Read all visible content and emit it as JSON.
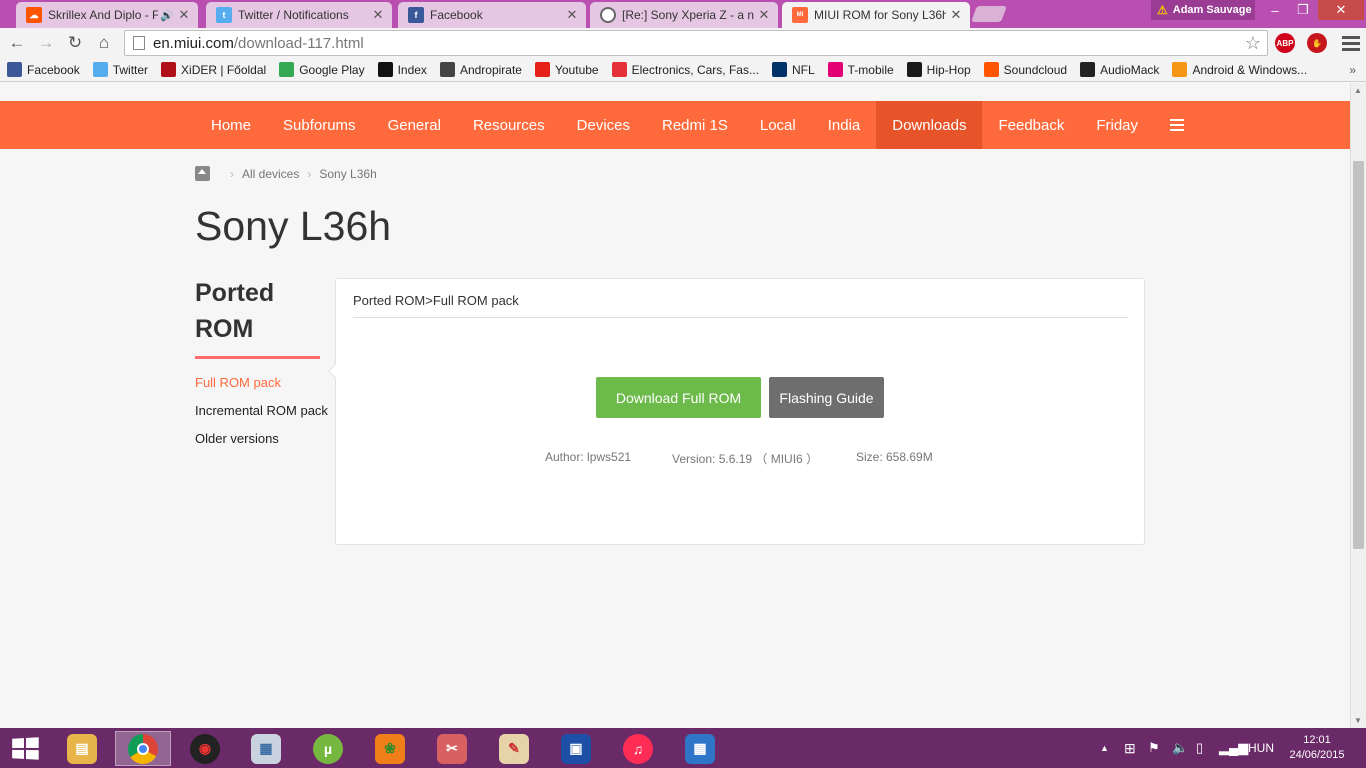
{
  "browser": {
    "tabs": [
      {
        "title": "Skrillex And Diplo - Fel",
        "icon": "soundcloud-icon",
        "color": "#ff5500",
        "audio": true,
        "active": false
      },
      {
        "title": "Twitter / Notifications",
        "icon": "twitter-icon",
        "color": "#55acee",
        "active": false
      },
      {
        "title": "Facebook",
        "icon": "facebook-icon",
        "color": "#3b5998",
        "active": false
      },
      {
        "title": "[Re:] Sony Xperia Z - a nac",
        "icon": "forum-icon",
        "color": "#666666",
        "active": false
      },
      {
        "title": "MIUI ROM for Sony L36h",
        "icon": "miui-icon",
        "color": "#ff6a3d",
        "active": true
      }
    ],
    "user": "Adam Sauvage",
    "address": {
      "host": "en.miui.com",
      "path": "/download-117.html"
    },
    "extensions": [
      "adblock-plus-icon",
      "stop-icon"
    ]
  },
  "bookmarks": [
    {
      "label": "Facebook",
      "icon": "facebook-icon",
      "color": "#3b5998"
    },
    {
      "label": "Twitter",
      "icon": "twitter-icon",
      "color": "#55acee"
    },
    {
      "label": "XiDER | Főoldal",
      "icon": "xider-icon",
      "color": "#b0101a"
    },
    {
      "label": "Google Play",
      "icon": "google-play-icon",
      "color": "#34a853"
    },
    {
      "label": "Index",
      "icon": "index-icon",
      "color": "#111111"
    },
    {
      "label": "Andropirate",
      "icon": "pirate-icon",
      "color": "#444444"
    },
    {
      "label": "Youtube",
      "icon": "youtube-icon",
      "color": "#e62117"
    },
    {
      "label": "Electronics, Cars, Fas...",
      "icon": "ebay-icon",
      "color": "#e53238"
    },
    {
      "label": "NFL",
      "icon": "nfl-icon",
      "color": "#013369"
    },
    {
      "label": "T-mobile",
      "icon": "t-mobile-icon",
      "color": "#e20074"
    },
    {
      "label": "Hip-Hop",
      "icon": "hiphop-icon",
      "color": "#1a1a1a"
    },
    {
      "label": "Soundcloud",
      "icon": "soundcloud-icon",
      "color": "#ff5500"
    },
    {
      "label": "AudioMack",
      "icon": "audiomack-icon",
      "color": "#222222"
    },
    {
      "label": "Android & Windows...",
      "icon": "xda-icon",
      "color": "#f59714"
    }
  ],
  "site": {
    "nav": [
      "Home",
      "Subforums",
      "General",
      "Resources",
      "Devices",
      "Redmi 1S",
      "Local",
      "India",
      "Downloads",
      "Feedback",
      "Friday"
    ],
    "nav_current": "Downloads",
    "accent": "#ff6a3d",
    "breadcrumb": [
      "All devices",
      "Sony L36h"
    ],
    "title": "Sony L36h",
    "sidebar": {
      "heading": "Ported ROM",
      "items": [
        "Full ROM pack",
        "Incremental ROM pack",
        "Older versions"
      ],
      "active": "Full ROM pack"
    },
    "panel": {
      "title": "Ported ROM>Full ROM pack",
      "download_label": "Download Full ROM",
      "guide_label": "Flashing Guide",
      "author": "Author: lpws521",
      "version": "Version: 5.6.19 （ MIUI6 ）",
      "size": "Size: 658.69M"
    }
  },
  "taskbar": {
    "apps": [
      "file-explorer-icon",
      "chrome-icon",
      "record-app-icon",
      "presentation-icon",
      "utorrent-icon",
      "fl-studio-icon",
      "snipping-tool-icon",
      "paint-icon",
      "floppy-save-icon",
      "itunes-icon",
      "calculator-icon"
    ],
    "language": "HUN",
    "time": "12:01",
    "date": "24/06/2015"
  }
}
